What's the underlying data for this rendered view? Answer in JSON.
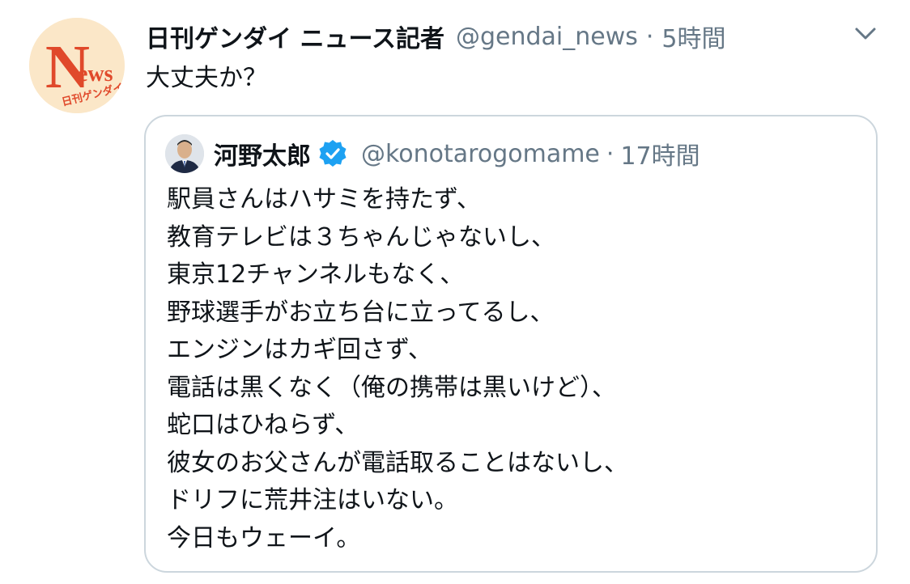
{
  "tweet": {
    "author_name": "日刊ゲンダイ ニュース記者",
    "handle": "@gendai_news",
    "separator": "·",
    "time": "5時間",
    "text": "大丈夫か？",
    "avatar_logo": {
      "big_letter": "N",
      "small_letters": "ews",
      "sub_text": "日刊ゲンダイ"
    },
    "icons": {
      "menu": "chevron-down-icon"
    }
  },
  "quote": {
    "author_name": "河野太郎",
    "verified_icon": "verified-badge-icon",
    "handle": "@konotarogomame",
    "separator": "·",
    "time": "17時間",
    "lines": [
      "駅員さんはハサミを持たず、",
      "教育テレビは３ちゃんじゃないし、",
      "東京12チャンネルもなく、",
      "野球選手がお立ち台に立ってるし、",
      "エンジンはカギ回さず、",
      "電話は黒くなく（俺の携帯は黒いけど）、",
      "蛇口はひねらず、",
      "彼女のお父さんが電話取ることはないし、",
      "ドリフに荒井注はいない。",
      "今日もウェーイ。"
    ]
  },
  "colors": {
    "text_primary": "#0f1419",
    "text_secondary": "#657786",
    "border": "#ccd6dd",
    "verified_blue": "#1da1f2",
    "logo_red": "#e0492b"
  }
}
